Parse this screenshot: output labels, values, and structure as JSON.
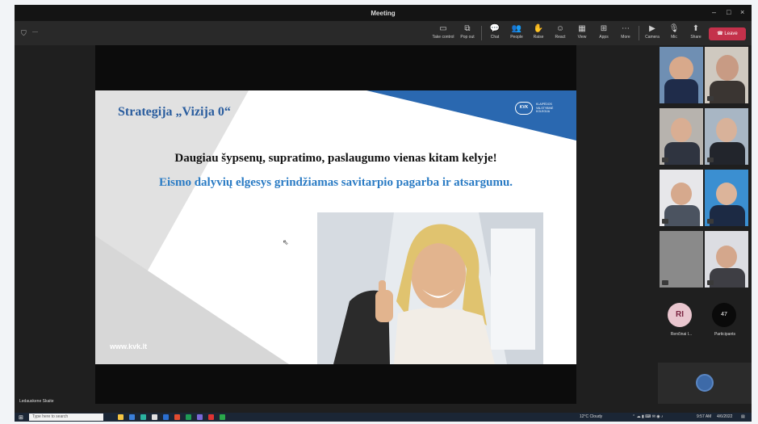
{
  "window": {
    "title": "Meeting",
    "controls": [
      "–",
      "□",
      "×"
    ]
  },
  "toolbar": {
    "buttons": [
      {
        "icon": "▭",
        "label": "Take control"
      },
      {
        "icon": "⧉",
        "label": "Pop out"
      },
      {
        "icon": "💬",
        "label": "Chat"
      },
      {
        "icon": "👥",
        "label": "People"
      },
      {
        "icon": "✋",
        "label": "Raise"
      },
      {
        "icon": "☺",
        "label": "React"
      },
      {
        "icon": "▦",
        "label": "View"
      },
      {
        "icon": "⊞",
        "label": "Apps"
      },
      {
        "icon": "⋯",
        "label": "More"
      },
      {
        "icon": "▶",
        "label": "Camera"
      },
      {
        "icon": "🎙",
        "label": "Mic"
      },
      {
        "icon": "⬆",
        "label": "Share"
      }
    ],
    "leave_label": "Leave",
    "leave_icon": "☎",
    "colors": {
      "leave": "#c4314b"
    }
  },
  "slide": {
    "title": "Strategija „Vizija 0“",
    "headline": "Daugiau šypsenų, supratimo, paslaugumo vienas kitam kelyje!",
    "subline": "Eismo dalyvių elgesys grindžiamas savitarpio pagarba ir atsargumu.",
    "website": "www.kvk.lt",
    "logo_mark": "KVK",
    "logo_text": "KLAIPĖDOS VALSTYBINĖ KOLEGIJA"
  },
  "gallery": {
    "avatar_initials": "RI",
    "avatar_name": "Renčinai I...",
    "participants_count": "47",
    "participants_label": "Participants"
  },
  "stage_label": "Ledauskene Skaite",
  "taskbar": {
    "search_placeholder": "Type here to search",
    "tray_weather": "12°C Cloudy",
    "tray_time": "9:57 AM",
    "tray_date": "4/6/2022"
  }
}
